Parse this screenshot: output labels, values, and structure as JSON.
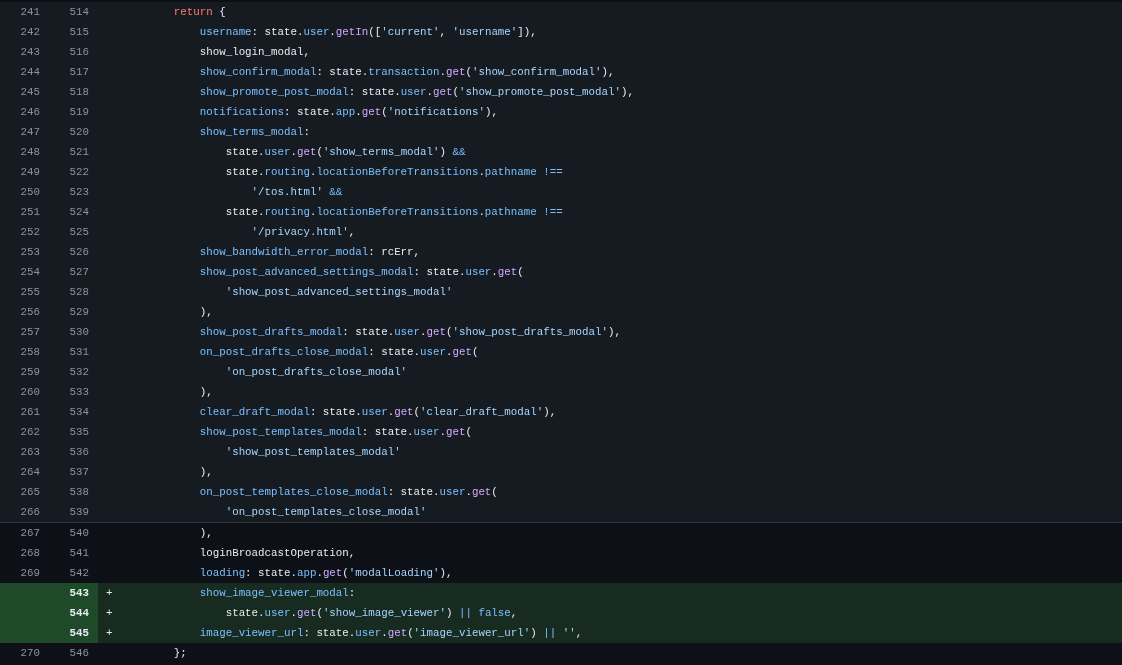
{
  "diff_lines": [
    {
      "kind": "expanded",
      "old": "241",
      "new": "514",
      "code": [
        {
          "kind": "k",
          "text": "        return"
        },
        {
          "kind": "t",
          "text": " {"
        }
      ]
    },
    {
      "kind": "expanded",
      "old": "242",
      "new": "515",
      "code": [
        {
          "kind": "p",
          "text": "            username"
        },
        {
          "kind": "t",
          "text": ": state."
        },
        {
          "kind": "m",
          "text": "user"
        },
        {
          "kind": "t",
          "text": "."
        },
        {
          "kind": "f",
          "text": "getIn"
        },
        {
          "kind": "t",
          "text": "(["
        },
        {
          "kind": "s",
          "text": "'current'"
        },
        {
          "kind": "t",
          "text": ", "
        },
        {
          "kind": "s",
          "text": "'username'"
        },
        {
          "kind": "t",
          "text": "]),"
        }
      ]
    },
    {
      "kind": "expanded",
      "old": "243",
      "new": "516",
      "code": [
        {
          "kind": "t",
          "text": "            show_login_modal,"
        }
      ]
    },
    {
      "kind": "expanded",
      "old": "244",
      "new": "517",
      "code": [
        {
          "kind": "p",
          "text": "            show_confirm_modal"
        },
        {
          "kind": "t",
          "text": ": state."
        },
        {
          "kind": "m",
          "text": "transaction"
        },
        {
          "kind": "t",
          "text": "."
        },
        {
          "kind": "f",
          "text": "get"
        },
        {
          "kind": "t",
          "text": "("
        },
        {
          "kind": "s",
          "text": "'show_confirm_modal'"
        },
        {
          "kind": "t",
          "text": "),"
        }
      ]
    },
    {
      "kind": "expanded",
      "old": "245",
      "new": "518",
      "code": [
        {
          "kind": "p",
          "text": "            show_promote_post_modal"
        },
        {
          "kind": "t",
          "text": ": state."
        },
        {
          "kind": "m",
          "text": "user"
        },
        {
          "kind": "t",
          "text": "."
        },
        {
          "kind": "f",
          "text": "get"
        },
        {
          "kind": "t",
          "text": "("
        },
        {
          "kind": "s",
          "text": "'show_promote_post_modal'"
        },
        {
          "kind": "t",
          "text": "),"
        }
      ]
    },
    {
      "kind": "expanded",
      "old": "246",
      "new": "519",
      "code": [
        {
          "kind": "p",
          "text": "            notifications"
        },
        {
          "kind": "t",
          "text": ": state."
        },
        {
          "kind": "m",
          "text": "app"
        },
        {
          "kind": "t",
          "text": "."
        },
        {
          "kind": "f",
          "text": "get"
        },
        {
          "kind": "t",
          "text": "("
        },
        {
          "kind": "s",
          "text": "'notifications'"
        },
        {
          "kind": "t",
          "text": "),"
        }
      ]
    },
    {
      "kind": "expanded",
      "old": "247",
      "new": "520",
      "code": [
        {
          "kind": "p",
          "text": "            show_terms_modal"
        },
        {
          "kind": "t",
          "text": ":"
        }
      ]
    },
    {
      "kind": "expanded",
      "old": "248",
      "new": "521",
      "code": [
        {
          "kind": "t",
          "text": "                state."
        },
        {
          "kind": "m",
          "text": "user"
        },
        {
          "kind": "t",
          "text": "."
        },
        {
          "kind": "f",
          "text": "get"
        },
        {
          "kind": "t",
          "text": "("
        },
        {
          "kind": "s",
          "text": "'show_terms_modal'"
        },
        {
          "kind": "t",
          "text": ") "
        },
        {
          "kind": "o",
          "text": "&&"
        }
      ]
    },
    {
      "kind": "expanded",
      "old": "249",
      "new": "522",
      "code": [
        {
          "kind": "t",
          "text": "                state."
        },
        {
          "kind": "m",
          "text": "routing"
        },
        {
          "kind": "t",
          "text": "."
        },
        {
          "kind": "m",
          "text": "locationBeforeTransitions"
        },
        {
          "kind": "t",
          "text": "."
        },
        {
          "kind": "m",
          "text": "pathname"
        },
        {
          "kind": "o",
          "text": " !=="
        }
      ]
    },
    {
      "kind": "expanded",
      "old": "250",
      "new": "523",
      "code": [
        {
          "kind": "s",
          "text": "                    '/tos.html'"
        },
        {
          "kind": "o",
          "text": " &&"
        }
      ]
    },
    {
      "kind": "expanded",
      "old": "251",
      "new": "524",
      "code": [
        {
          "kind": "t",
          "text": "                state."
        },
        {
          "kind": "m",
          "text": "routing"
        },
        {
          "kind": "t",
          "text": "."
        },
        {
          "kind": "m",
          "text": "locationBeforeTransitions"
        },
        {
          "kind": "t",
          "text": "."
        },
        {
          "kind": "m",
          "text": "pathname"
        },
        {
          "kind": "o",
          "text": " !=="
        }
      ]
    },
    {
      "kind": "expanded",
      "old": "252",
      "new": "525",
      "code": [
        {
          "kind": "s",
          "text": "                    '/privacy.html'"
        },
        {
          "kind": "t",
          "text": ","
        }
      ]
    },
    {
      "kind": "expanded",
      "old": "253",
      "new": "526",
      "code": [
        {
          "kind": "p",
          "text": "            show_bandwidth_error_modal"
        },
        {
          "kind": "t",
          "text": ": rcErr,"
        }
      ]
    },
    {
      "kind": "expanded",
      "old": "254",
      "new": "527",
      "code": [
        {
          "kind": "p",
          "text": "            show_post_advanced_settings_modal"
        },
        {
          "kind": "t",
          "text": ": state."
        },
        {
          "kind": "m",
          "text": "user"
        },
        {
          "kind": "t",
          "text": "."
        },
        {
          "kind": "f",
          "text": "get"
        },
        {
          "kind": "t",
          "text": "("
        }
      ]
    },
    {
      "kind": "expanded",
      "old": "255",
      "new": "528",
      "code": [
        {
          "kind": "s",
          "text": "                'show_post_advanced_settings_modal'"
        }
      ]
    },
    {
      "kind": "expanded",
      "old": "256",
      "new": "529",
      "code": [
        {
          "kind": "t",
          "text": "            ),"
        }
      ]
    },
    {
      "kind": "expanded",
      "old": "257",
      "new": "530",
      "code": [
        {
          "kind": "p",
          "text": "            show_post_drafts_modal"
        },
        {
          "kind": "t",
          "text": ": state."
        },
        {
          "kind": "m",
          "text": "user"
        },
        {
          "kind": "t",
          "text": "."
        },
        {
          "kind": "f",
          "text": "get"
        },
        {
          "kind": "t",
          "text": "("
        },
        {
          "kind": "s",
          "text": "'show_post_drafts_modal'"
        },
        {
          "kind": "t",
          "text": "),"
        }
      ]
    },
    {
      "kind": "expanded",
      "old": "258",
      "new": "531",
      "code": [
        {
          "kind": "p",
          "text": "            on_post_drafts_close_modal"
        },
        {
          "kind": "t",
          "text": ": state."
        },
        {
          "kind": "m",
          "text": "user"
        },
        {
          "kind": "t",
          "text": "."
        },
        {
          "kind": "f",
          "text": "get"
        },
        {
          "kind": "t",
          "text": "("
        }
      ]
    },
    {
      "kind": "expanded",
      "old": "259",
      "new": "532",
      "code": [
        {
          "kind": "s",
          "text": "                'on_post_drafts_close_modal'"
        }
      ]
    },
    {
      "kind": "expanded",
      "old": "260",
      "new": "533",
      "code": [
        {
          "kind": "t",
          "text": "            ),"
        }
      ]
    },
    {
      "kind": "expanded",
      "old": "261",
      "new": "534",
      "code": [
        {
          "kind": "p",
          "text": "            clear_draft_modal"
        },
        {
          "kind": "t",
          "text": ": state."
        },
        {
          "kind": "m",
          "text": "user"
        },
        {
          "kind": "t",
          "text": "."
        },
        {
          "kind": "f",
          "text": "get"
        },
        {
          "kind": "t",
          "text": "("
        },
        {
          "kind": "s",
          "text": "'clear_draft_modal'"
        },
        {
          "kind": "t",
          "text": "),"
        }
      ]
    },
    {
      "kind": "expanded",
      "old": "262",
      "new": "535",
      "code": [
        {
          "kind": "p",
          "text": "            show_post_templates_modal"
        },
        {
          "kind": "t",
          "text": ": state."
        },
        {
          "kind": "m",
          "text": "user"
        },
        {
          "kind": "t",
          "text": "."
        },
        {
          "kind": "f",
          "text": "get"
        },
        {
          "kind": "t",
          "text": "("
        }
      ]
    },
    {
      "kind": "expanded",
      "old": "263",
      "new": "536",
      "code": [
        {
          "kind": "s",
          "text": "                'show_post_templates_modal'"
        }
      ]
    },
    {
      "kind": "expanded",
      "old": "264",
      "new": "537",
      "code": [
        {
          "kind": "t",
          "text": "            ),"
        }
      ]
    },
    {
      "kind": "expanded",
      "old": "265",
      "new": "538",
      "code": [
        {
          "kind": "p",
          "text": "            on_post_templates_close_modal"
        },
        {
          "kind": "t",
          "text": ": state."
        },
        {
          "kind": "m",
          "text": "user"
        },
        {
          "kind": "t",
          "text": "."
        },
        {
          "kind": "f",
          "text": "get"
        },
        {
          "kind": "t",
          "text": "("
        }
      ]
    },
    {
      "kind": "expanded",
      "old": "266",
      "new": "539",
      "code": [
        {
          "kind": "s",
          "text": "                'on_post_templates_close_modal'"
        }
      ]
    },
    {
      "kind": "context",
      "old": "267",
      "new": "540",
      "code": [
        {
          "kind": "t",
          "text": "            ),"
        }
      ]
    },
    {
      "kind": "context",
      "old": "268",
      "new": "541",
      "code": [
        {
          "kind": "t",
          "text": "            loginBroadcastOperation,"
        }
      ]
    },
    {
      "kind": "context",
      "old": "269",
      "new": "542",
      "code": [
        {
          "kind": "p",
          "text": "            loading"
        },
        {
          "kind": "t",
          "text": ": state."
        },
        {
          "kind": "m",
          "text": "app"
        },
        {
          "kind": "t",
          "text": "."
        },
        {
          "kind": "f",
          "text": "get"
        },
        {
          "kind": "t",
          "text": "("
        },
        {
          "kind": "s",
          "text": "'modalLoading'"
        },
        {
          "kind": "t",
          "text": "),"
        }
      ]
    },
    {
      "kind": "added",
      "new": "543",
      "marker": "+",
      "code": [
        {
          "kind": "p",
          "text": "            show_image_viewer_modal"
        },
        {
          "kind": "t",
          "text": ":"
        }
      ]
    },
    {
      "kind": "added",
      "new": "544",
      "marker": "+",
      "code": [
        {
          "kind": "t",
          "text": "                state."
        },
        {
          "kind": "m",
          "text": "user"
        },
        {
          "kind": "t",
          "text": "."
        },
        {
          "kind": "f",
          "text": "get"
        },
        {
          "kind": "t",
          "text": "("
        },
        {
          "kind": "s",
          "text": "'show_image_viewer'"
        },
        {
          "kind": "t",
          "text": ") "
        },
        {
          "kind": "o",
          "text": "|| false"
        },
        {
          "kind": "t",
          "text": ","
        }
      ]
    },
    {
      "kind": "added",
      "new": "545",
      "marker": "+",
      "code": [
        {
          "kind": "p",
          "text": "            image_viewer_url"
        },
        {
          "kind": "t",
          "text": ": state."
        },
        {
          "kind": "m",
          "text": "user"
        },
        {
          "kind": "t",
          "text": "."
        },
        {
          "kind": "f",
          "text": "get"
        },
        {
          "kind": "t",
          "text": "("
        },
        {
          "kind": "s",
          "text": "'image_viewer_url'"
        },
        {
          "kind": "t",
          "text": ") "
        },
        {
          "kind": "o",
          "text": "||"
        },
        {
          "kind": "s",
          "text": " ''"
        },
        {
          "kind": "t",
          "text": ","
        }
      ]
    },
    {
      "kind": "context",
      "old": "270",
      "new": "546",
      "code": [
        {
          "kind": "t",
          "text": "        };"
        }
      ]
    }
  ]
}
